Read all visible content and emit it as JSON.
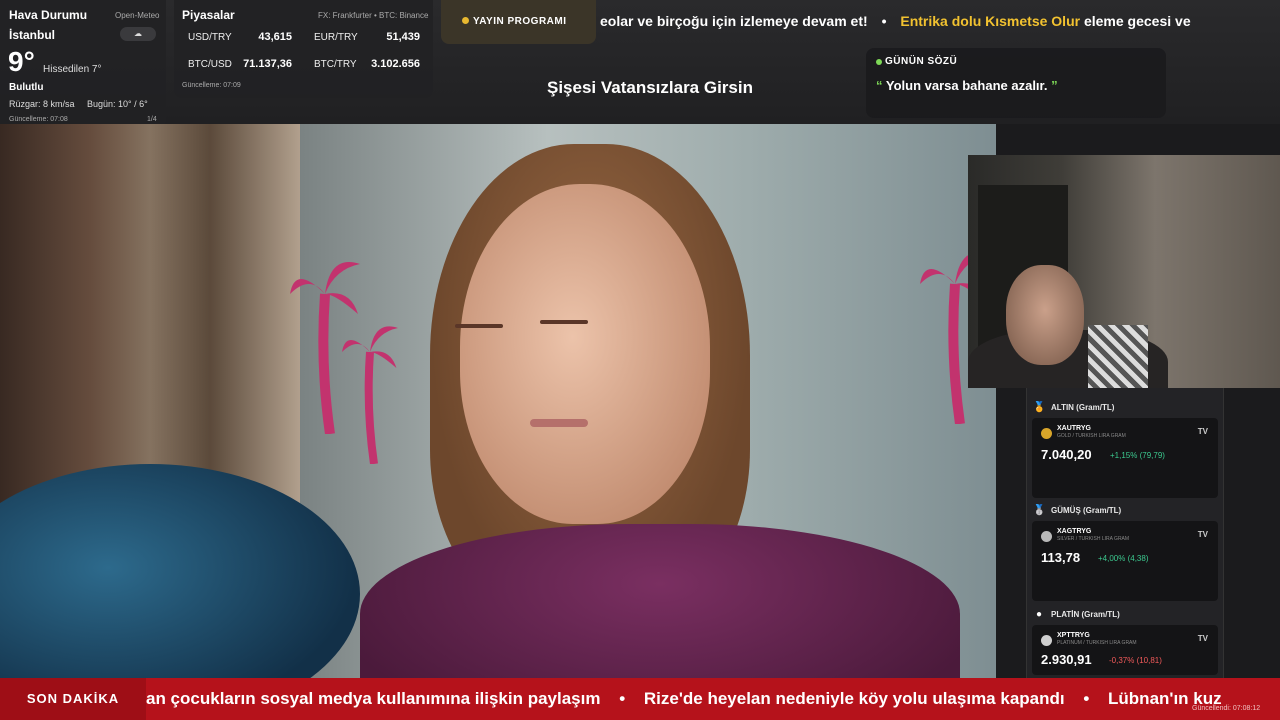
{
  "weather": {
    "title": "Hava Durumu",
    "source": "Open-Meteo",
    "city": "İstanbul",
    "icon": "cloud-icon",
    "temperature": "9°",
    "feels_like": "Hissedilen 7°",
    "condition": "Bulutlu",
    "wind": "Rüzgar: 8 km/sa",
    "today": "Bugün: 10° / 6°",
    "updated": "Güncelleme: 07:08",
    "page": "1/4"
  },
  "markets": {
    "title": "Piyasalar",
    "source": "FX: Frankfurter • BTC: Binance",
    "rows": [
      {
        "left_label": "USD/TRY",
        "left_value": "43,615",
        "right_label": "EUR/TRY",
        "right_value": "51,439"
      },
      {
        "left_label": "BTC/USD",
        "left_value": "71.137,36",
        "right_label": "BTC/TRY",
        "right_value": "3.102.656"
      }
    ],
    "updated": "Güncelleme: 07:09"
  },
  "yayin": {
    "label": "YAYIN PROGRAMI",
    "dot_color": "#e8b830"
  },
  "top_ticker": {
    "text_white": "eolar ve birçoğu için izlemeye devam et!",
    "text_gold": "Entrika dolu Kısmetse Olur",
    "text_white_2": "eleme gecesi ve",
    "gold_color": "#f2c230"
  },
  "show_title": "Şişesi Vatansızlara Girsin",
  "quote": {
    "label": "GÜNÜN SÖZÜ",
    "open_mark": "“",
    "text": "Yolun varsa bahane azalır.",
    "close_mark": "”",
    "accent": "#7ed957"
  },
  "commodities": [
    {
      "title": "ALTIN (Gram/TL)",
      "medal": "gold-medal-icon",
      "symbol": "XAUTRYG",
      "desc": "GOLD / TURKISH LIRA GRAM",
      "price": "7.040,20",
      "change": "+1,15% (79,79)",
      "direction": "up",
      "coin_color": "#d8a52a"
    },
    {
      "title": "GÜMÜŞ (Gram/TL)",
      "medal": "silver-medal-icon",
      "symbol": "XAGTRYG",
      "desc": "SILVER / TURKISH LIRA GRAM",
      "price": "113,78",
      "change": "+4,00% (4,38)",
      "direction": "up",
      "coin_color": "#b8b8b8"
    },
    {
      "title": "PLATİN (Gram/TL)",
      "medal": "platinum-dot-icon",
      "symbol": "XPTTRYG",
      "desc": "PLATINUM / TURKISH LIRA GRAM",
      "price": "2.930,91",
      "change": "-0,37% (10,81)",
      "direction": "down",
      "coin_color": "#cfcfcf"
    }
  ],
  "bottom_ticker": {
    "label": "SON DAKİKA",
    "items": [
      "an çocukların sosyal medya kullanımına ilişkin paylaşım",
      "Rize'de heyelan nedeniyle köy yolu ulaşıma kapandı",
      "Lübnan'ın kuz"
    ],
    "separator": "•",
    "updated": "Güncellendi: 07:08:12",
    "bg_color": "#b5121b"
  }
}
